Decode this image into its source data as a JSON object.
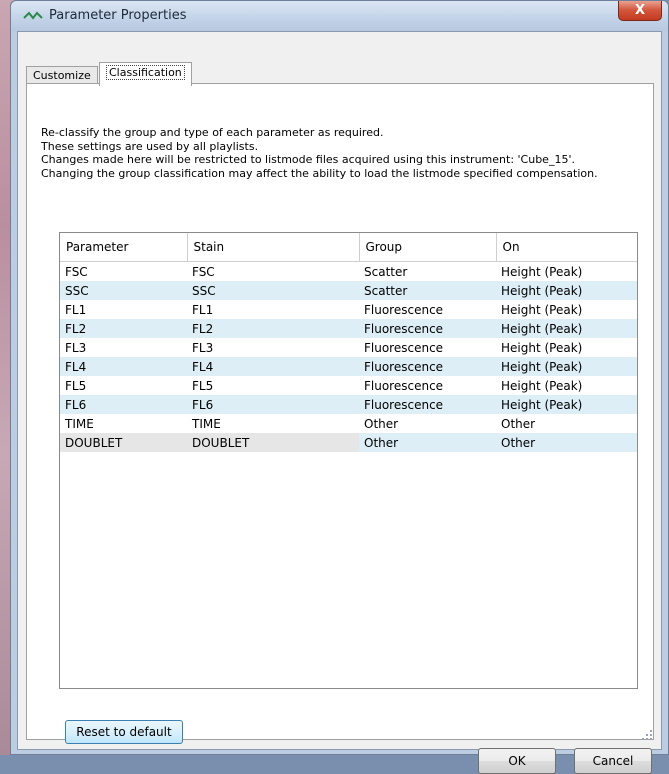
{
  "window": {
    "title": "Parameter Properties",
    "close_label": "X"
  },
  "tabs": [
    {
      "label": "Customize",
      "active": false
    },
    {
      "label": "Classification",
      "active": true
    }
  ],
  "description": [
    "Re-classify the group and type of each parameter as required.",
    "These settings are used by all playlists.",
    "Changes made here will be restricted to listmode files acquired using this instrument: 'Cube_15'.",
    "Changing the group classification may affect the ability to load the listmode specified compensation."
  ],
  "table": {
    "columns": [
      "Parameter",
      "Stain",
      "Group",
      "On"
    ],
    "rows": [
      [
        "FSC",
        "FSC",
        "Scatter",
        "Height (Peak)"
      ],
      [
        "SSC",
        "SSC",
        "Scatter",
        "Height (Peak)"
      ],
      [
        "FL1",
        "FL1",
        "Fluorescence",
        "Height (Peak)"
      ],
      [
        "FL2",
        "FL2",
        "Fluorescence",
        "Height (Peak)"
      ],
      [
        "FL3",
        "FL3",
        "Fluorescence",
        "Height (Peak)"
      ],
      [
        "FL4",
        "FL4",
        "Fluorescence",
        "Height (Peak)"
      ],
      [
        "FL5",
        "FL5",
        "Fluorescence",
        "Height (Peak)"
      ],
      [
        "FL6",
        "FL6",
        "Fluorescence",
        "Height (Peak)"
      ],
      [
        "TIME",
        "TIME",
        "Other",
        "Other"
      ],
      [
        "DOUBLET",
        "DOUBLET",
        "Other",
        "Other"
      ]
    ]
  },
  "buttons": {
    "reset": "Reset to default",
    "ok": "OK",
    "cancel": "Cancel"
  }
}
